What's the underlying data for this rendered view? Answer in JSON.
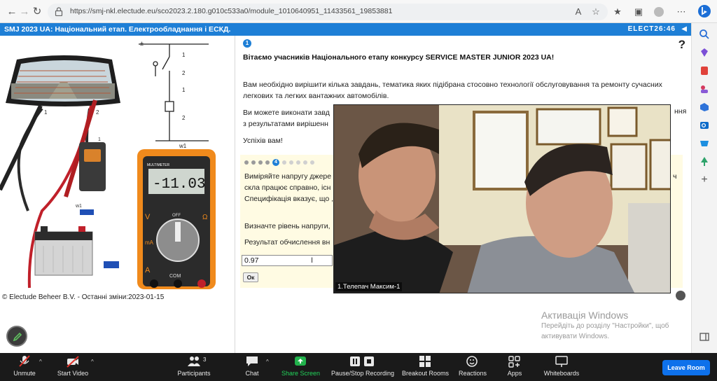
{
  "browser": {
    "url": "https://smj-nkl.electude.eu/sco2023.2.180.g010c533a0/module_1010640951_11433561_19853881",
    "nav_back": "←",
    "nav_forward": "→",
    "nav_reload": "↻",
    "tool_read": "A",
    "tool_more": "⋯"
  },
  "app": {
    "title": "SMJ 2023 UA: Національний етап. Електрообладнання і ЕСКД.",
    "brand": "ELECT",
    "clock": "26:46"
  },
  "left_pane": {
    "multimeter_reading": "-11.03",
    "multimeter_brand": "MULTIMETER",
    "labels": {
      "com": "COM",
      "off": "OFF",
      "v": "V",
      "ma": "mA",
      "a": "A",
      "ohm": "Ω",
      "one": "1",
      "two": "2",
      "w1": "w1"
    },
    "copyright": "© Electude Beheer B.V. - Останні зміни:2023-01-15"
  },
  "content": {
    "step_number": "1",
    "help": "?",
    "greeting": "Вітаємо учасників Національного етапу конкурсу SERVICE MASTER JUNIOR 2023 UA!",
    "para1_line1": "Вам необхідно вирішити кілька завдань, тематика яких підібрана стосовно технології обслуговування та ремонту сучасних",
    "para1_line2": "легкових та легких вантажних автомобілів.",
    "para2_line1": "Ви можете виконати завд",
    "para2_line1_tail": "ння",
    "para2_line2": "з результатами вирішенн",
    "para3": "Успіхів вам!",
    "task": {
      "current_step": "4",
      "line1": "Виміряйте напругу джере",
      "line1_tail": "ч",
      "line2": "скла працює справно, існ",
      "line3": "Специфікація вказує, що ,",
      "line4": "Визначте рівень напруги,",
      "line5": "Результат обчислення вн",
      "answer_value": "0.97",
      "ok_label": "Ок"
    }
  },
  "video": {
    "participant_name": "1.Телепач Максим-1"
  },
  "watermark": {
    "title": "Активація Windows",
    "line1": "Перейдіть до розділу \"Настройки\", щоб",
    "line2": "активувати Windows."
  },
  "zoom": {
    "unmute": "Unmute",
    "start_video": "Start Video",
    "participants": "Participants",
    "participants_count": "3",
    "chat": "Chat",
    "share_screen": "Share Screen",
    "recording": "Pause/Stop Recording",
    "breakout": "Breakout Rooms",
    "reactions": "Reactions",
    "apps": "Apps",
    "whiteboards": "Whiteboards",
    "leave": "Leave Room"
  }
}
